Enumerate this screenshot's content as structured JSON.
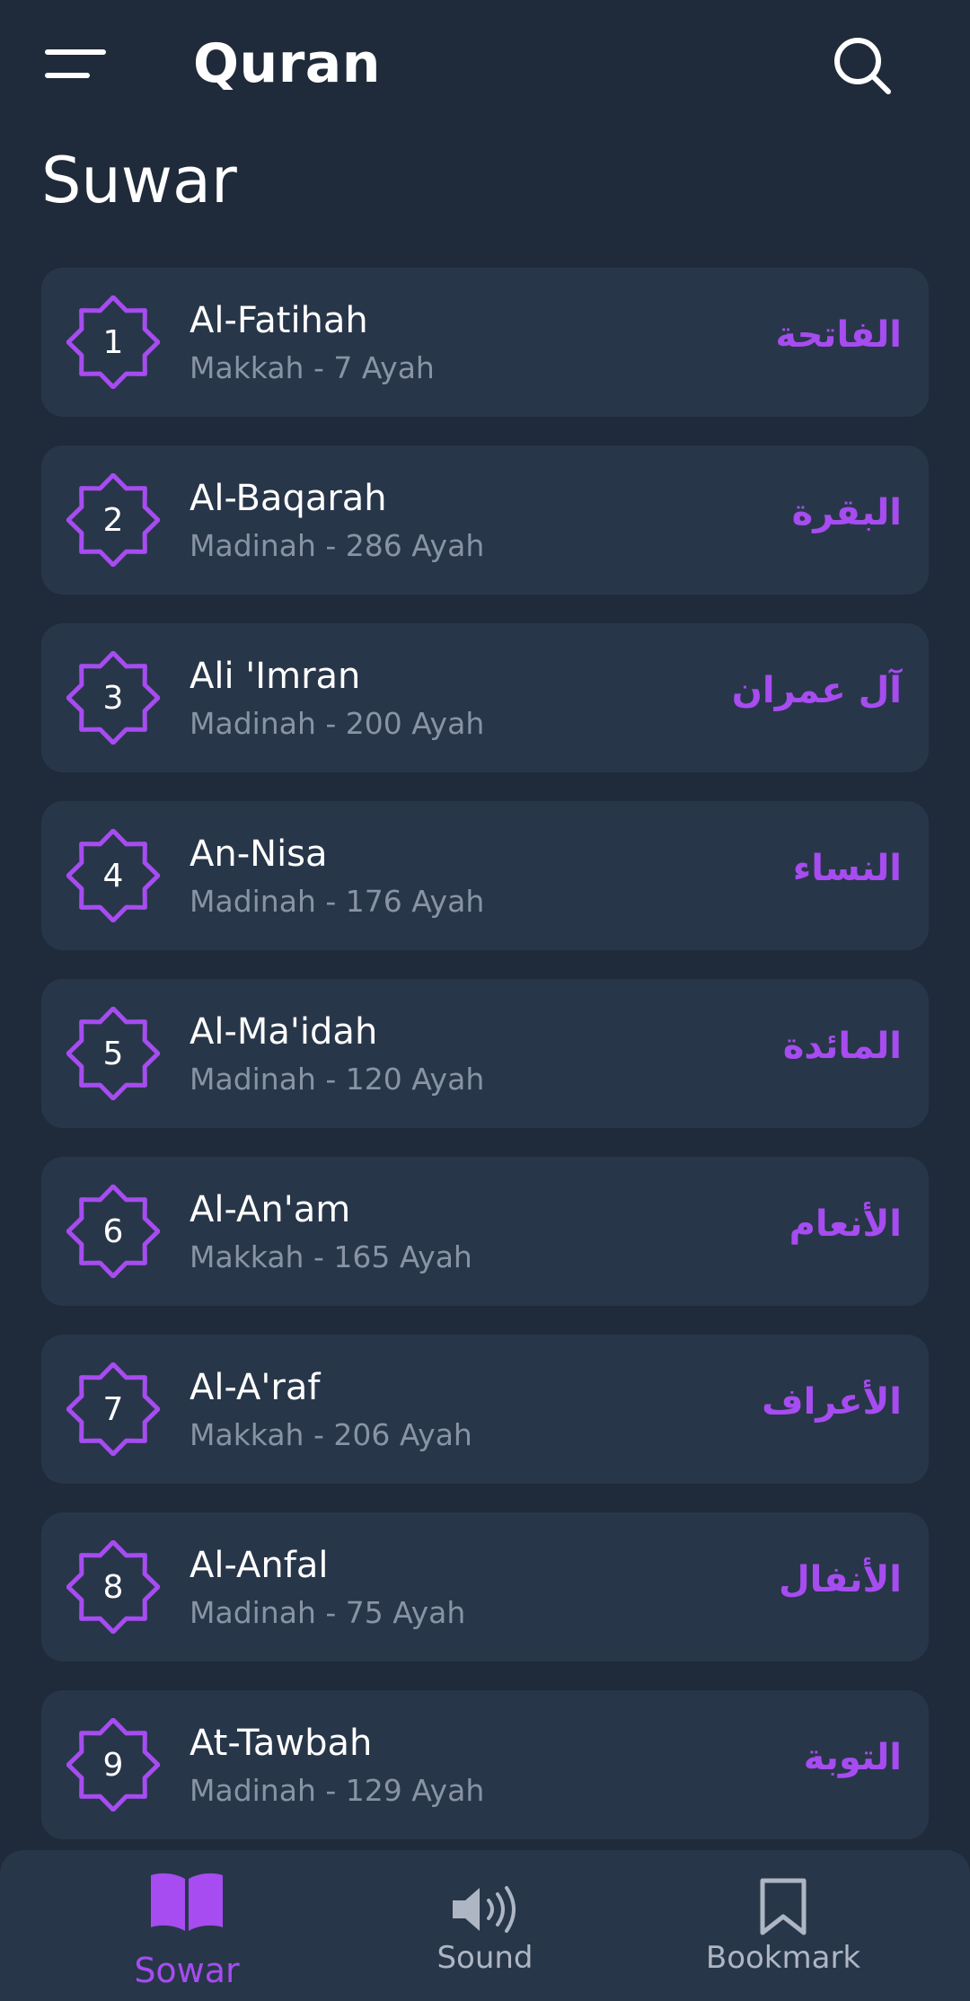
{
  "header": {
    "title": "Quran"
  },
  "section_title": "Suwar",
  "accent_color": "#a64cf0",
  "suwar": [
    {
      "number": "1",
      "name": "Al-Fatihah",
      "info": "Makkah - 7 Ayah",
      "arabic": "الفاتحة"
    },
    {
      "number": "2",
      "name": "Al-Baqarah",
      "info": "Madinah - 286 Ayah",
      "arabic": "البقرة"
    },
    {
      "number": "3",
      "name": "Ali 'Imran",
      "info": "Madinah - 200 Ayah",
      "arabic": "آل عمران"
    },
    {
      "number": "4",
      "name": "An-Nisa",
      "info": "Madinah - 176 Ayah",
      "arabic": "النساء"
    },
    {
      "number": "5",
      "name": "Al-Ma'idah",
      "info": "Madinah - 120 Ayah",
      "arabic": "المائدة"
    },
    {
      "number": "6",
      "name": "Al-An'am",
      "info": "Makkah - 165 Ayah",
      "arabic": "الأنعام"
    },
    {
      "number": "7",
      "name": "Al-A'raf",
      "info": "Makkah - 206 Ayah",
      "arabic": "الأعراف"
    },
    {
      "number": "8",
      "name": "Al-Anfal",
      "info": "Madinah - 75 Ayah",
      "arabic": "الأنفال"
    },
    {
      "number": "9",
      "name": "At-Tawbah",
      "info": "Madinah - 129 Ayah",
      "arabic": "التوبة"
    }
  ],
  "nav": {
    "items": [
      {
        "label": "Sowar",
        "icon": "book-icon",
        "active": true
      },
      {
        "label": "Sound",
        "icon": "speaker-icon",
        "active": false
      },
      {
        "label": "Bookmark",
        "icon": "bookmark-icon",
        "active": false
      }
    ]
  }
}
